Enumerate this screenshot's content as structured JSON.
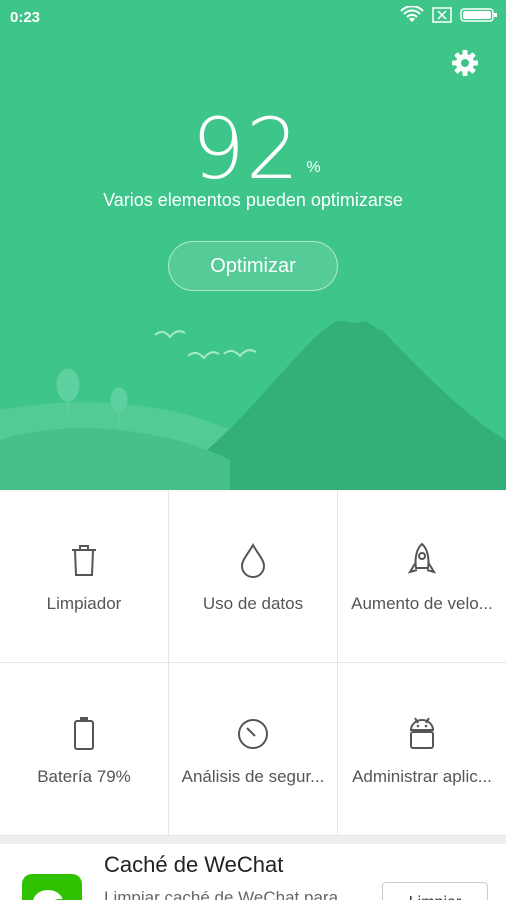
{
  "status_bar": {
    "time": "0:23"
  },
  "hero": {
    "score": "92",
    "score_unit": "%",
    "subtitle": "Varios elementos pueden optimizarse",
    "optimize_label": "Optimizar",
    "bg_color": "#3ec58a"
  },
  "tools": [
    {
      "label": "Limpiador",
      "icon": "trash-icon"
    },
    {
      "label": "Uso de datos",
      "icon": "drop-icon"
    },
    {
      "label": "Aumento de velo...",
      "icon": "rocket-icon"
    },
    {
      "label": "Batería 79%",
      "icon": "battery-icon"
    },
    {
      "label": "Análisis de segur...",
      "icon": "timer-icon"
    },
    {
      "label": "Administrar aplic...",
      "icon": "android-icon"
    }
  ],
  "card": {
    "title": "Caché de WeChat",
    "description": "Limpiar caché de WeChat para",
    "button": "Limpiar"
  }
}
